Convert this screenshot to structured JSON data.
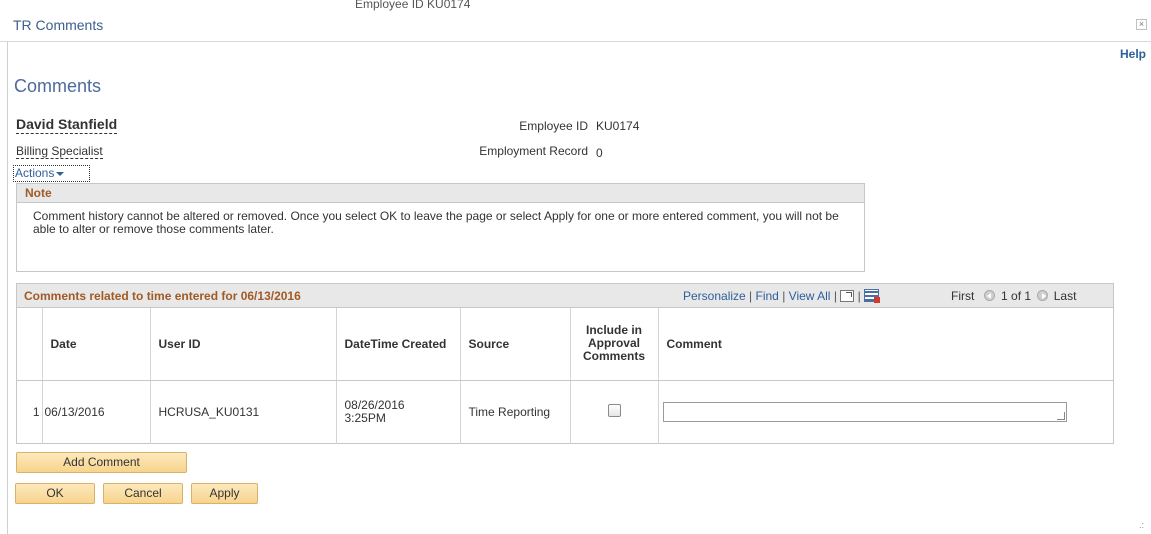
{
  "window": {
    "title": "TR Comments",
    "close_glyph": "×",
    "background_text": "Employee ID KU0174"
  },
  "help_label": "Help",
  "page_title": "Comments",
  "employee": {
    "name": "David Stanfield",
    "job_title": "Billing Specialist",
    "employee_id_label": "Employee ID",
    "employee_id": "KU0174",
    "employment_record_label": "Employment Record",
    "employment_record": "0"
  },
  "actions_label": "Actions",
  "note": {
    "heading": "Note",
    "text": "Comment history cannot be altered or removed. Once you select OK to leave the page or select Apply for one or more entered comment, you will not be able to alter or remove those comments later."
  },
  "grid": {
    "title": "Comments related to time entered for 06/13/2016",
    "personalize": "Personalize",
    "find": "Find",
    "view_all": "View All",
    "separator": "|",
    "first": "First",
    "range": "1 of 1",
    "last": "Last",
    "columns": {
      "date": "Date",
      "user_id": "User ID",
      "datetime_created": "DateTime Created",
      "source": "Source",
      "include": "Include in Approval Comments",
      "comment": "Comment"
    },
    "rows": [
      {
        "num": "1",
        "date": "06/13/2016",
        "user_id": "HCRUSA_KU0131",
        "datetime_created": "08/26/2016 3:25PM",
        "source": "Time Reporting",
        "include": false,
        "comment": ""
      }
    ]
  },
  "buttons": {
    "add_comment": "Add Comment",
    "ok": "OK",
    "cancel": "Cancel",
    "apply": "Apply"
  },
  "icons": {
    "close": "close-icon",
    "actions_caret": "chevron-down-icon",
    "zoom": "new-window-icon",
    "download": "download-excel-icon",
    "first": "arrow-left-icon",
    "last": "arrow-right-icon"
  },
  "colors": {
    "link": "#2d5f9a",
    "section_heading": "#a05a25",
    "button_fill": "#f7d48c"
  }
}
